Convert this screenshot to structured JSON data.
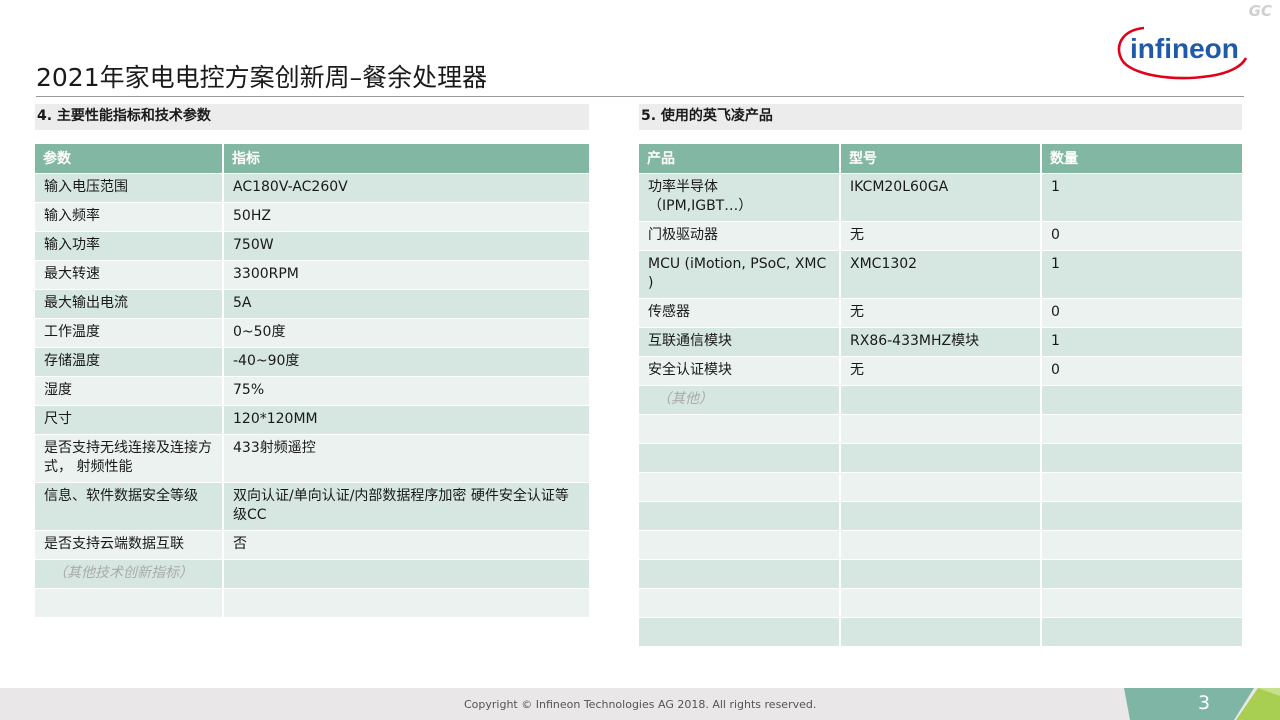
{
  "watermark": "GC",
  "logo_text": "infineon",
  "title": "2021年家电电控方案创新周–餐余处理器",
  "left": {
    "heading": "4. 主要性能指标和技术参数",
    "headers": [
      "参数",
      "指标"
    ],
    "rows": [
      {
        "p": "输入电压范围",
        "v": "AC180V-AC260V"
      },
      {
        "p": "输入频率",
        "v": "50HZ"
      },
      {
        "p": "输入功率",
        "v": "750W"
      },
      {
        "p": "最大转速",
        "v": "3300RPM"
      },
      {
        "p": "最大输出电流",
        "v": "5A"
      },
      {
        "p": "工作温度",
        "v": "0~50度"
      },
      {
        "p": "存储温度",
        "v": "-40~90度"
      },
      {
        "p": "湿度",
        "v": "75%"
      },
      {
        "p": "尺寸",
        "v": "120*120MM"
      },
      {
        "p": "是否支持无线连接及连接方式， 射频性能",
        "v": "433射频遥控"
      },
      {
        "p": "信息、软件数据安全等级",
        "v": "双向认证/单向认证/内部数据程序加密 硬件安全认证等级CC"
      },
      {
        "p": "是否支持云端数据互联",
        "v": "否"
      },
      {
        "p": "（其他技术创新指标）",
        "v": ""
      },
      {
        "p": "",
        "v": ""
      }
    ]
  },
  "right": {
    "heading": "5. 使用的英飞凌产品",
    "headers": [
      "产品",
      "型号",
      "数量"
    ],
    "rows": [
      {
        "p": "功率半导体\n（IPM,IGBT…）",
        "m": "IKCM20L60GA",
        "q": "1"
      },
      {
        "p": "门极驱动器",
        "m": "无",
        "q": "0"
      },
      {
        "p": "MCU (iMotion, PSoC, XMC )",
        "m": "XMC1302",
        "q": "1"
      },
      {
        "p": "传感器",
        "m": "无",
        "q": "0"
      },
      {
        "p": "互联通信模块",
        "m": "RX86-433MHZ模块",
        "q": "1"
      },
      {
        "p": "安全认证模块",
        "m": "无",
        "q": "0"
      },
      {
        "p": "（其他）",
        "m": "",
        "q": ""
      },
      {
        "p": "",
        "m": "",
        "q": ""
      },
      {
        "p": "",
        "m": "",
        "q": ""
      },
      {
        "p": "",
        "m": "",
        "q": ""
      },
      {
        "p": "",
        "m": "",
        "q": ""
      },
      {
        "p": "",
        "m": "",
        "q": ""
      },
      {
        "p": "",
        "m": "",
        "q": ""
      },
      {
        "p": "",
        "m": "",
        "q": ""
      },
      {
        "p": "",
        "m": "",
        "q": ""
      }
    ]
  },
  "footer": {
    "copyright": "Copyright © Infineon Technologies AG 2018. All rights reserved.",
    "page": "3"
  },
  "colors": {
    "header": "#82b7a3",
    "row_odd": "#d6e6e0",
    "row_even": "#ebf2ef",
    "brand_blue": "#1e5aa8",
    "brand_red": "#e2001a"
  }
}
